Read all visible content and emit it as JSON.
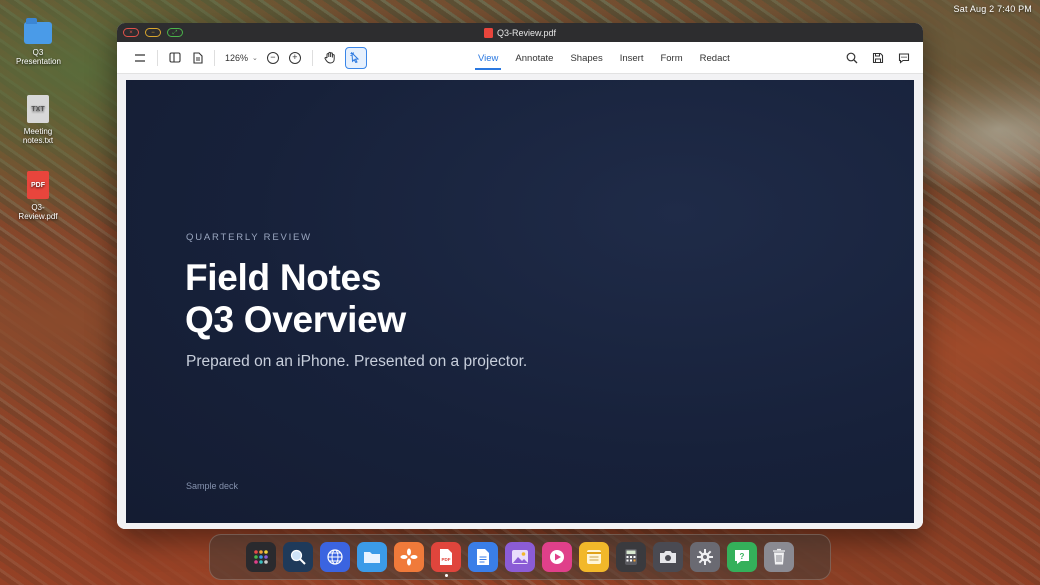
{
  "menubar": {
    "clock": "Sat Aug 2 7:40 PM"
  },
  "desktop": {
    "icons": [
      {
        "label": "Q3 Presentation",
        "kind": "folder"
      },
      {
        "label": "Meeting notes.txt",
        "kind": "txt",
        "badge": "TXT"
      },
      {
        "label": "Q3-Review.pdf",
        "kind": "pdf",
        "badge": "PDF"
      }
    ]
  },
  "window": {
    "title": "Q3-Review.pdf",
    "traffic": {
      "close": "×",
      "minimize": "−",
      "maximize": "⤢"
    },
    "toolbar": {
      "zoom_value": "126%",
      "tabs": [
        "View",
        "Annotate",
        "Shapes",
        "Insert",
        "Form",
        "Redact"
      ],
      "active_tab": "View"
    },
    "slide": {
      "kicker": "QUARTERLY REVIEW",
      "headline_line1": "Field Notes",
      "headline_line2": "Q3 Overview",
      "subtitle": "Prepared on an iPhone. Presented on a projector.",
      "footer": "Sample deck"
    }
  },
  "dock": {
    "apps": [
      {
        "name": "launchpad-icon",
        "color": "#2a2a2e"
      },
      {
        "name": "finder-search-icon",
        "color": "#1f3a5a"
      },
      {
        "name": "browser-globe-icon",
        "color": "#3b64e0"
      },
      {
        "name": "files-folder-icon",
        "color": "#3b9be8"
      },
      {
        "name": "photos-flower-icon",
        "color": "#f07a3a"
      },
      {
        "name": "pdf-reader-icon",
        "color": "#e0453c"
      },
      {
        "name": "docs-icon",
        "color": "#3a7ee8"
      },
      {
        "name": "gallery-icon",
        "color": "#8b5cd6"
      },
      {
        "name": "media-player-icon",
        "color": "#e0408a"
      },
      {
        "name": "notes-icon",
        "color": "#f2b82a"
      },
      {
        "name": "calculator-icon",
        "color": "#3a3a3e"
      },
      {
        "name": "camera-icon",
        "color": "#4a4a52"
      },
      {
        "name": "settings-gear-icon",
        "color": "#6a6a72"
      },
      {
        "name": "help-icon",
        "color": "#34b05a"
      },
      {
        "name": "trash-icon",
        "color": "#8a8a92"
      }
    ]
  }
}
